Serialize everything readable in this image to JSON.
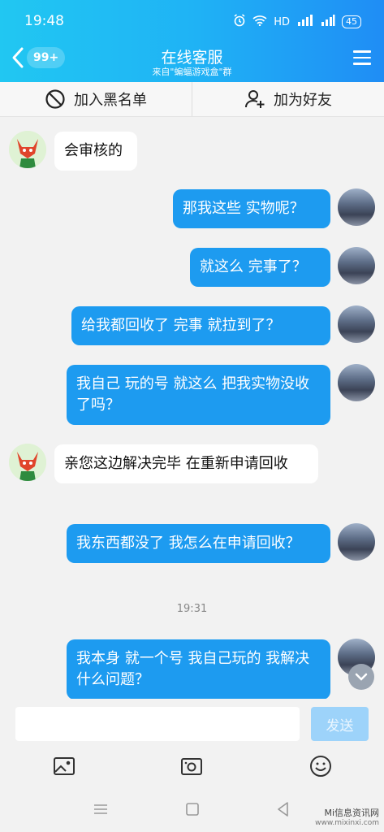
{
  "status_bar": {
    "time": "19:48",
    "network": "HD",
    "signal": "4G",
    "battery": "45"
  },
  "header": {
    "badge": "99+",
    "title": "在线客服",
    "subtitle": "来自\"蝙蝠游戏盒\"群"
  },
  "actions": {
    "block": "加入黑名单",
    "add_friend": "加为好友"
  },
  "messages": [
    {
      "side": "in",
      "text": "会审核的"
    },
    {
      "side": "out",
      "text": "那我这些  实物呢？"
    },
    {
      "side": "out",
      "text": "就这么  完事了？"
    },
    {
      "side": "out",
      "text": "给我都回收了  完事   就拉到了？"
    },
    {
      "side": "out",
      "text": "我自己  玩的号  就这么  把我实物没收了吗？"
    },
    {
      "side": "in",
      "text": "亲您这边解决完毕 在重新申请回收"
    },
    {
      "side": "out",
      "text": "我东西都没了   我怎么在申请回收？"
    },
    {
      "side": "out",
      "text": "我本身  就一个号  我自己玩的  我解决什么问题？"
    }
  ],
  "timestamp": "19:31",
  "composer": {
    "placeholder": "",
    "send_label": "发送"
  },
  "watermark": {
    "name": "Mi信息资讯网",
    "url": "www.mixinxi.com"
  },
  "colors": {
    "accent": "#1d9bf0",
    "header_start": "#21c7f2",
    "header_end": "#1f8df5"
  }
}
